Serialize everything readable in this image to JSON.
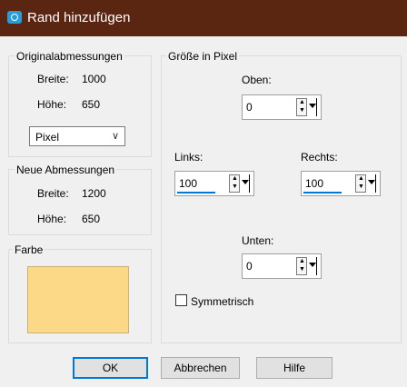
{
  "window": {
    "title": "Rand hinzufügen",
    "title_icon": "camera-icon"
  },
  "original": {
    "heading": "Originalabmessungen",
    "width_label": "Breite:",
    "width_value": "1000",
    "height_label": "Höhe:",
    "height_value": "650",
    "unit": "Pixel"
  },
  "new_size": {
    "heading": "Neue Abmessungen",
    "width_label": "Breite:",
    "width_value": "1200",
    "height_label": "Höhe:",
    "height_value": "650"
  },
  "color": {
    "heading": "Farbe",
    "swatch": "#fcd986"
  },
  "size_px": {
    "heading": "Größe in Pixel",
    "top_label": "Oben:",
    "top_value": "0",
    "left_label": "Links:",
    "left_value": "100",
    "right_label": "Rechts:",
    "right_value": "100",
    "bottom_label": "Unten:",
    "bottom_value": "0",
    "symmetric_label": "Symmetrisch",
    "symmetric_checked": false
  },
  "buttons": {
    "ok": "OK",
    "cancel": "Abbrechen",
    "help": "Hilfe"
  },
  "colors": {
    "titlebar": "#5a2612",
    "focus": "#0078d7"
  }
}
